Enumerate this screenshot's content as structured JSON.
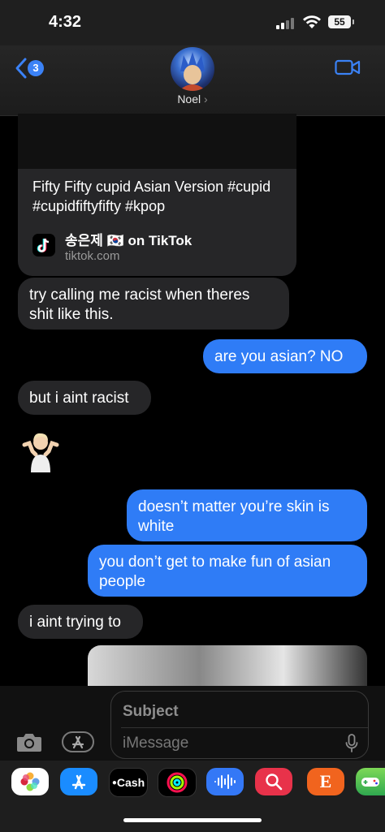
{
  "status": {
    "time": "4:32",
    "battery": "55"
  },
  "header": {
    "back_badge": "3",
    "contact_name": "Noel",
    "name_chevron": "›"
  },
  "link_card": {
    "title": "Fifty Fifty cupid Asian Version #cupid #cupidfiftyfifty #kpop",
    "source": "송은제 🇰🇷 on TikTok",
    "domain": "tiktok.com"
  },
  "messages": [
    {
      "dir": "in",
      "text": "try calling me racist when theres shit like this."
    },
    {
      "dir": "out",
      "text": "are you asian? NO"
    },
    {
      "dir": "in",
      "text": "but i aint racist"
    },
    {
      "dir": "in",
      "text": "🤷🏼‍♂️"
    },
    {
      "dir": "out",
      "text": "doesn’t matter you’re skin is white"
    },
    {
      "dir": "out",
      "text": "you don’t get to make fun of asian people"
    },
    {
      "dir": "in",
      "text": "i aint trying to"
    }
  ],
  "compose": {
    "subject_placeholder": "Subject",
    "message_placeholder": "iMessage"
  },
  "tray": {
    "apps": [
      {
        "name": "photos-app",
        "label": ""
      },
      {
        "name": "app-store-app",
        "label": ""
      },
      {
        "name": "apple-cash-app",
        "label": "Cash"
      },
      {
        "name": "activity-app",
        "label": ""
      },
      {
        "name": "audio-message-app",
        "label": ""
      },
      {
        "name": "image-search-app",
        "label": ""
      },
      {
        "name": "etsy-app",
        "label": "E"
      },
      {
        "name": "game-app",
        "label": ""
      }
    ]
  },
  "colors": {
    "outgoing_bubble": "#2f7cf6",
    "incoming_bubble": "#262628",
    "accent": "#3b82f6"
  }
}
